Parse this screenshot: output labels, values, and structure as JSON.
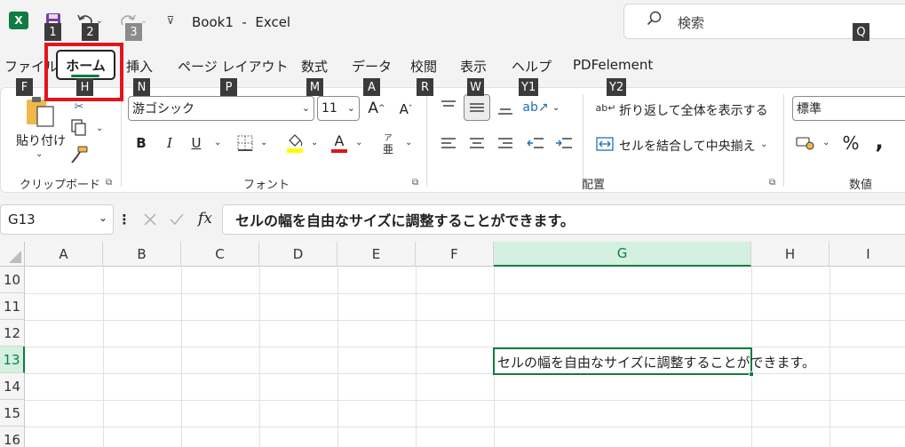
{
  "title_bar": {
    "excel_logo": "X",
    "document_title": "Book1  -  Excel",
    "search_placeholder": "検索"
  },
  "keytips": {
    "qat_save": "1",
    "qat_undo": "2",
    "qat_redo": "3",
    "search": "Q",
    "file": "F",
    "home": "H",
    "insert": "N",
    "page_layout": "P",
    "formulas": "M",
    "data": "A",
    "review": "R",
    "view": "W",
    "help": "Y1",
    "pdfelement": "Y2"
  },
  "tabs": {
    "file": "ファイル",
    "home": "ホーム",
    "insert": "挿入",
    "page_layout": "ページ レイアウト",
    "formulas": "数式",
    "data": "データ",
    "review": "校閲",
    "view": "表示",
    "help": "ヘルプ",
    "pdfelement": "PDFelement"
  },
  "ribbon": {
    "clipboard": {
      "paste_label": "貼り付け",
      "group_label": "クリップボード"
    },
    "font": {
      "font_name": "游ゴシック",
      "font_size": "11",
      "bold": "B",
      "italic": "I",
      "underline": "U",
      "font_color_letter": "A",
      "phonetic_top": "ア",
      "phonetic_bottom": "亜",
      "group_label": "フォント"
    },
    "alignment": {
      "wrap_text": "折り返して全体を表示する",
      "merge_center": "セルを結合して中央揃え",
      "group_label": "配置"
    },
    "number": {
      "format": "標準",
      "percent": "%",
      "comma": ",",
      "group_label": "数値"
    }
  },
  "formula_bar": {
    "name_box": "G13",
    "fx": "fx",
    "content": "セルの幅を自由なサイズに調整することができます。"
  },
  "grid": {
    "columns": [
      "A",
      "B",
      "C",
      "D",
      "E",
      "F",
      "G",
      "H",
      "I"
    ],
    "rows": [
      "10",
      "11",
      "12",
      "13",
      "14",
      "15",
      "16"
    ],
    "active_cell": "G13",
    "active_cell_text": "セルの幅を自由なサイズに調整することができます。"
  },
  "colors": {
    "excel_green": "#107c41",
    "highlight_red": "#e0161c"
  }
}
